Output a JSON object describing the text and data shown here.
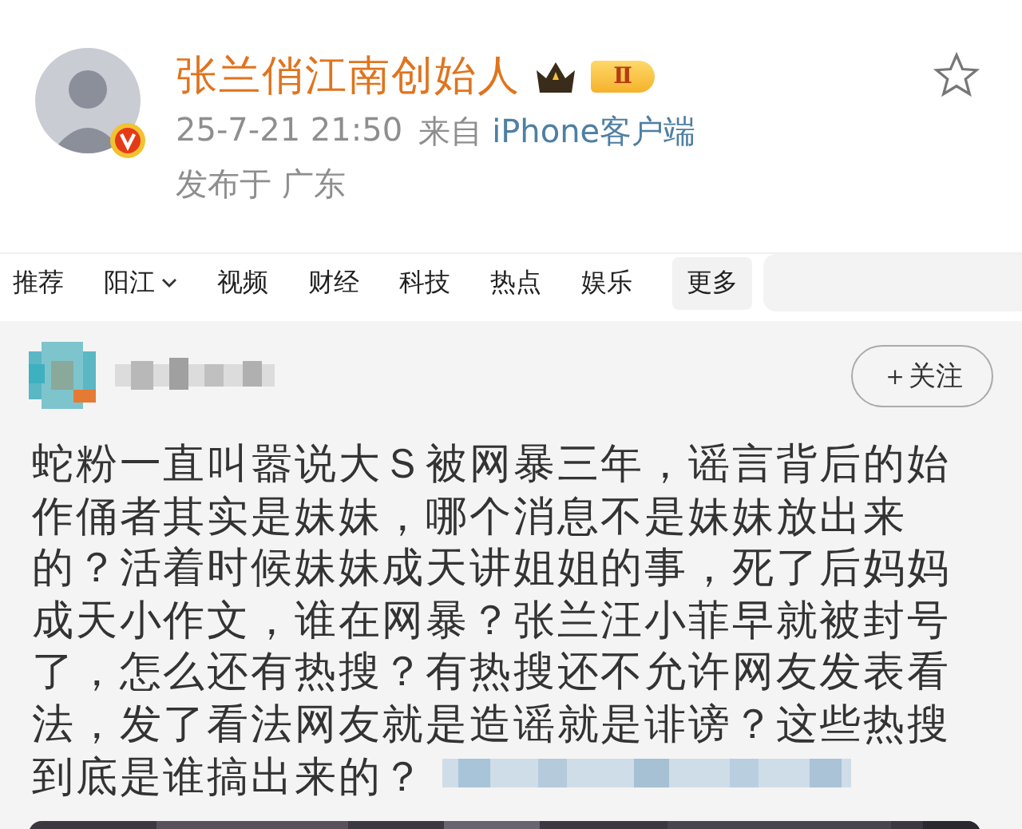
{
  "author": {
    "name": "张兰俏江南创始人",
    "verified": true,
    "level_badge": "Ⅱ",
    "time": "25-7-21 21:50",
    "source_prefix": "来自",
    "source": "iPhone客户端",
    "location": "发布于 广东",
    "favorited": false
  },
  "nav": {
    "items": [
      {
        "label": "推荐",
        "has_dropdown": false,
        "kind": "plain"
      },
      {
        "label": "阳江",
        "has_dropdown": true,
        "kind": "plain"
      },
      {
        "label": "视频",
        "has_dropdown": false,
        "kind": "plain"
      },
      {
        "label": "财经",
        "has_dropdown": false,
        "kind": "plain"
      },
      {
        "label": "科技",
        "has_dropdown": false,
        "kind": "plain"
      },
      {
        "label": "热点",
        "has_dropdown": false,
        "kind": "plain"
      },
      {
        "label": "娱乐",
        "has_dropdown": false,
        "kind": "plain"
      },
      {
        "label": "更多",
        "has_dropdown": false,
        "kind": "more"
      }
    ]
  },
  "post": {
    "follow_button": "＋关注",
    "text": "蛇粉一直叫嚣说大Ｓ被网暴三年，谣言背后的始作俑者其实是妹妹，哪个消息不是妹妹放出来的？活着时候妹妹成天讲姐姐的事，死了后妈妈成天小作文，谁在网暴？张兰汪小菲早就被封号了，怎么还有热搜？有热搜还不允许网友发表看法，发了看法网友就是造谣就是诽谤？这些热搜到底是谁搞出来的？"
  }
}
